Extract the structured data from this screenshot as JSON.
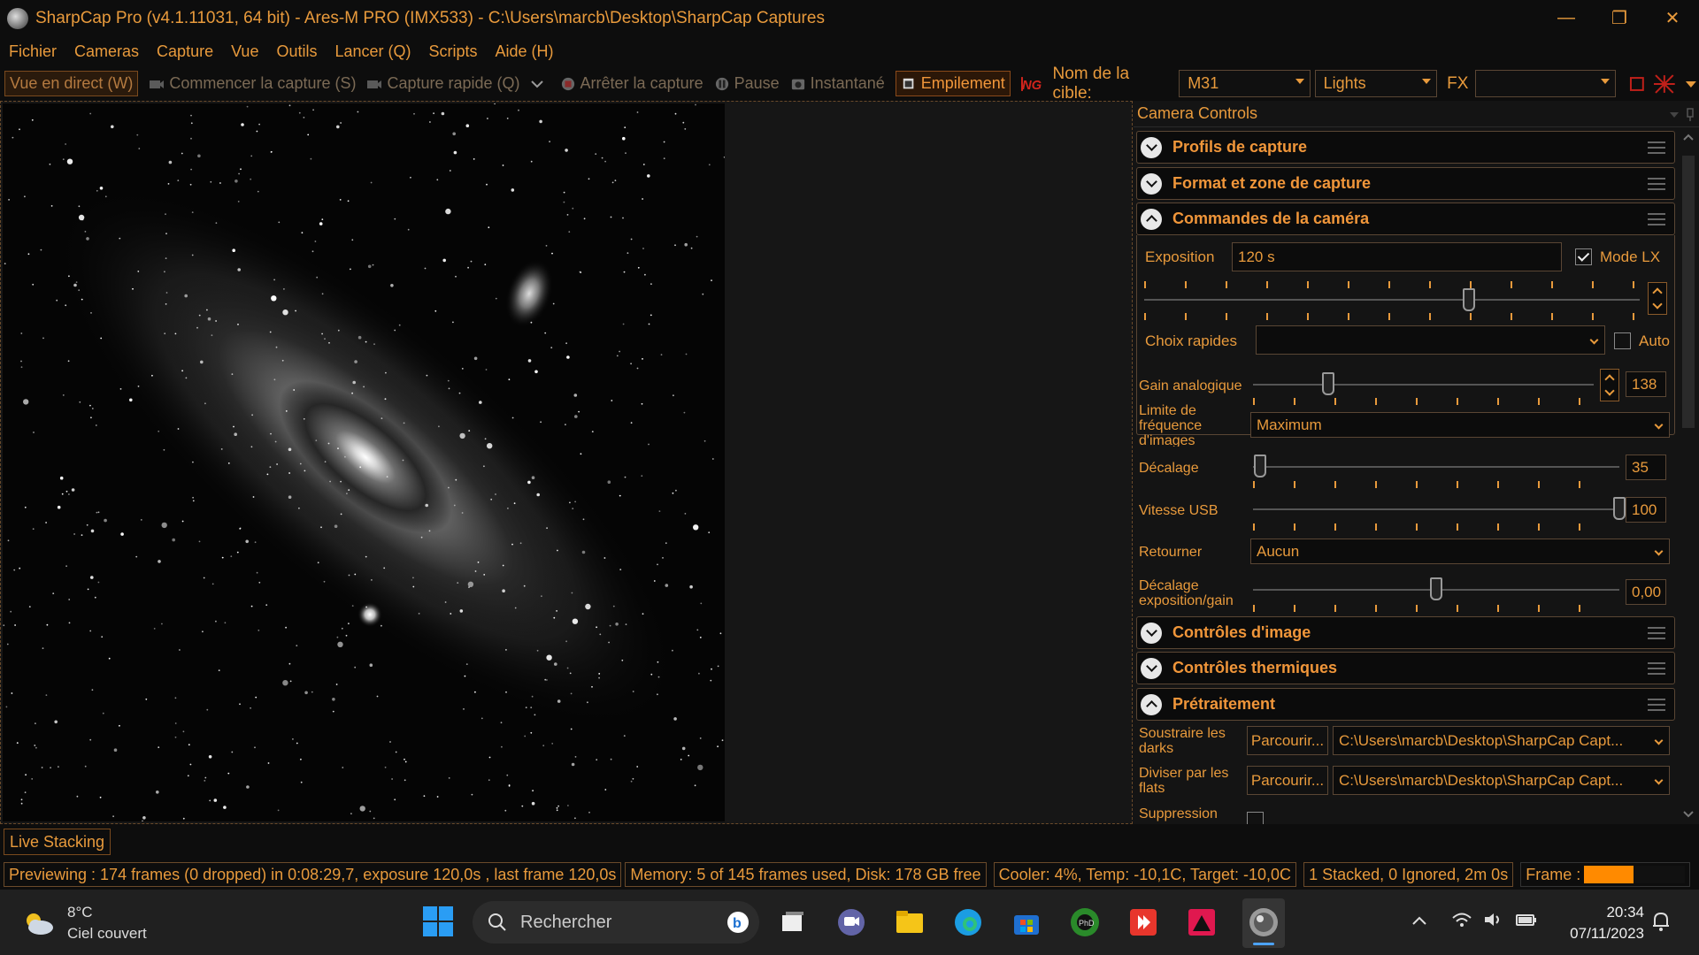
{
  "window": {
    "title": "SharpCap Pro (v4.1.11031, 64 bit) - Ares-M PRO (IMX533) - C:\\Users\\marcb\\Desktop\\SharpCap Captures",
    "minimize": "—",
    "maximize": "❐",
    "close": "✕"
  },
  "menu": [
    "Fichier",
    "Cameras",
    "Capture",
    "Vue",
    "Outils",
    "Lancer (Q)",
    "Scripts",
    "Aide (H)"
  ],
  "toolbar": {
    "live_view": "Vue en direct (W)",
    "start_capture": "Commencer la capture (S)",
    "quick_capture": "Capture rapide (Q)",
    "stop_capture": "Arrêter la capture",
    "pause": "Pause",
    "snapshot": "Instantané",
    "stacking": "Empilement",
    "target_label": "Nom de la cible:",
    "target_value": "M31",
    "frame_type": "Lights",
    "fx_label": "FX",
    "fx_value": ""
  },
  "panel": {
    "title": "Camera Controls",
    "sections": {
      "capture_profiles": "Profils de capture",
      "format_area": "Format et zone de capture",
      "camera_controls": "Commandes de la caméra",
      "image_controls": "Contrôles d'image",
      "thermal_controls": "Contrôles thermiques",
      "preprocessing": "Prétraitement"
    },
    "exposure": {
      "label": "Exposition",
      "value": "120 s",
      "lx_label": "Mode LX",
      "lx_checked": true
    },
    "quick_picks": {
      "label": "Choix rapides",
      "value": "",
      "auto_label": "Auto"
    },
    "gain": {
      "label": "Gain analogique",
      "value": "138",
      "fraction": 0.22
    },
    "frame_limit": {
      "label": "Limite de fréquence d'images",
      "value": "Maximum"
    },
    "offset": {
      "label": "Décalage",
      "value": "35",
      "fraction": 0.02
    },
    "usb_speed": {
      "label": "Vitesse USB",
      "value": "100",
      "fraction": 1.0
    },
    "flip": {
      "label": "Retourner",
      "value": "Aucun"
    },
    "exp_gain_offset": {
      "label": "Décalage exposition/gain",
      "value": "0,00",
      "fraction": 0.5
    },
    "darks": {
      "label": "Soustraire les darks",
      "browse": "Parcourir...",
      "path": "C:\\Users\\marcb\\Desktop\\SharpCap Capt..."
    },
    "flats": {
      "label": "Diviser par les flats",
      "browse": "Parcourir...",
      "path": "C:\\Users\\marcb\\Desktop\\SharpCap Capt..."
    },
    "suppression": {
      "label": "Suppression"
    }
  },
  "live_stacking_tab": "Live Stacking",
  "status": {
    "preview": "Previewing : 174 frames (0 dropped) in 0:08:29,7, exposure 120,0s , last frame 120,0s",
    "memory": "Memory: 5 of 145 frames used, Disk: 178 GB free",
    "cooler": "Cooler: 4%, Temp: -10,1C, Target: -10,0C",
    "stacked": "1 Stacked, 0 Ignored, 2m 0s",
    "frame_label": "Frame :",
    "frame_progress": 0.45
  },
  "taskbar": {
    "temperature": "8°C",
    "weather": "Ciel couvert",
    "search_placeholder": "Rechercher",
    "time": "20:34",
    "date": "07/11/2023"
  },
  "colors": {
    "accent": "#e89a3c",
    "background": "#141414",
    "border": "#5a4634"
  }
}
